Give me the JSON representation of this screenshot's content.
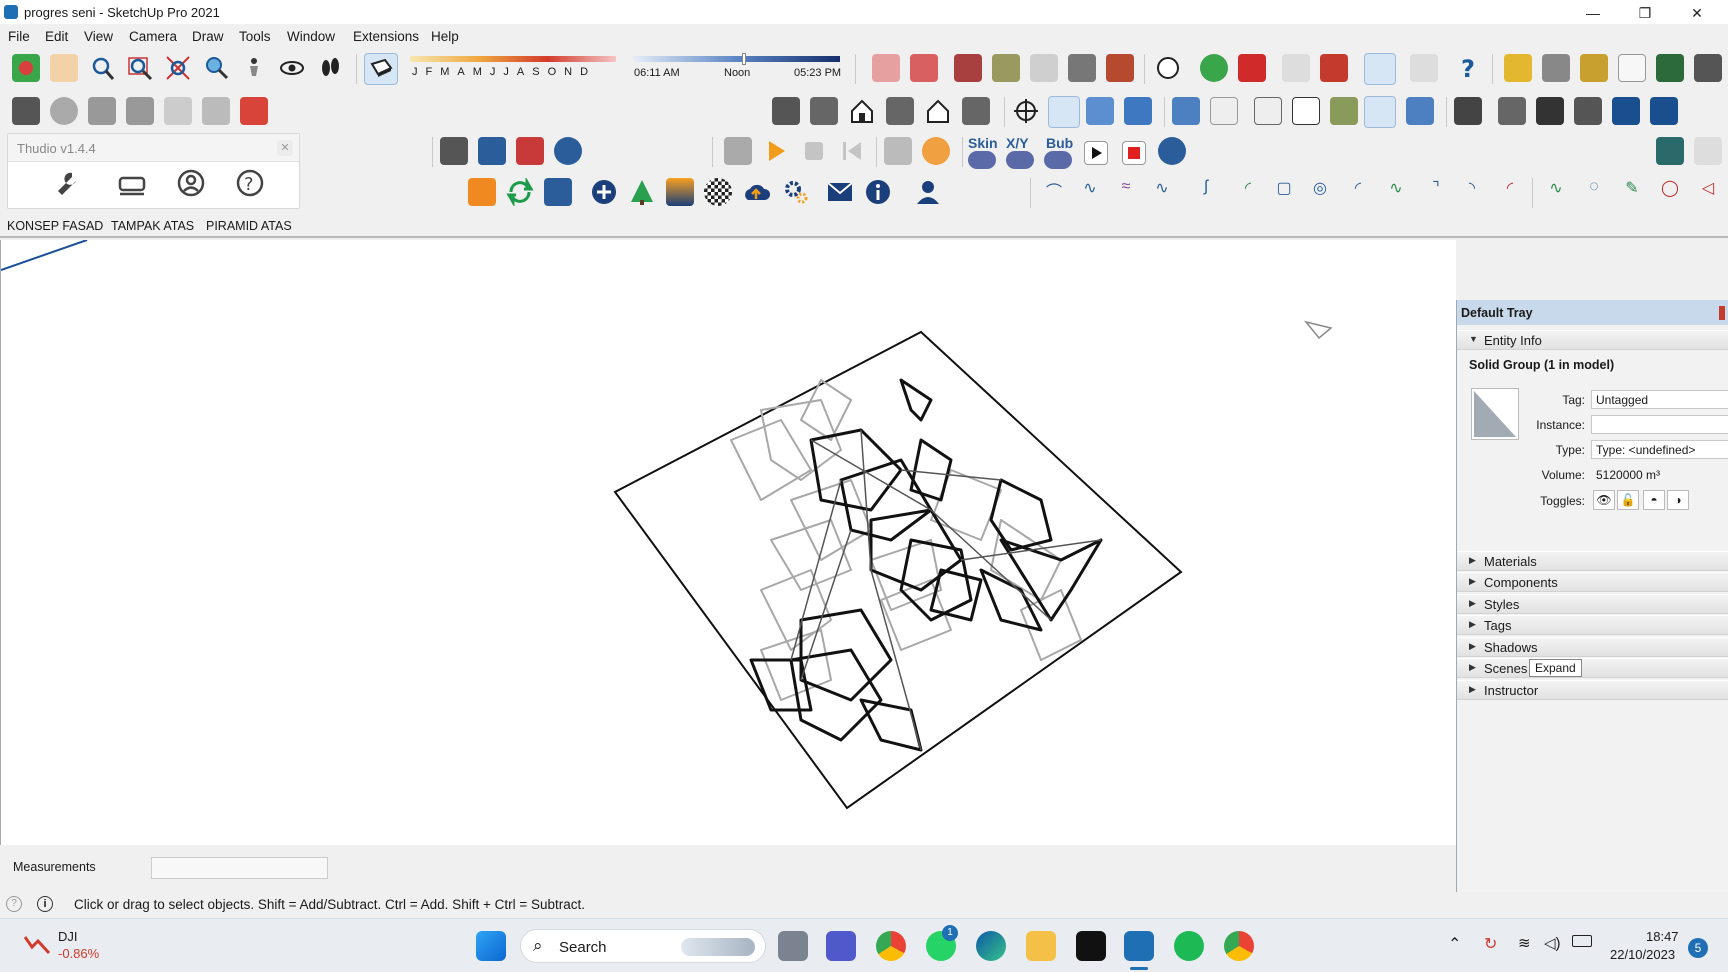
{
  "window": {
    "title": "progres seni - SketchUp Pro 2021",
    "minimize": "—",
    "restore": "❐",
    "close": "✕"
  },
  "menu": [
    "File",
    "Edit",
    "View",
    "Camera",
    "Draw",
    "Tools",
    "Window",
    "Extensions",
    "Help"
  ],
  "shadows": {
    "months": [
      "J",
      "F",
      "M",
      "A",
      "M",
      "J",
      "J",
      "A",
      "S",
      "O",
      "N",
      "D"
    ],
    "time_start": "06:11 AM",
    "time_mid": "Noon",
    "time_end": "05:23 PM"
  },
  "plugins": {
    "skin": "Skin",
    "xy": "X/Y",
    "bub": "Bub"
  },
  "thudio": {
    "title": "Thudio v1.4.4",
    "close": "✕"
  },
  "scenes": [
    "KONSEP FASAD",
    "TAMPAK ATAS",
    "PIRAMID ATAS"
  ],
  "tray": {
    "title": "Default Tray",
    "entity_info_label": "Entity Info",
    "entity_title": "Solid Group (1 in model)",
    "tag_label": "Tag:",
    "tag_value": "Untagged",
    "instance_label": "Instance:",
    "instance_value": "",
    "type_label": "Type:",
    "type_value": "Type: <undefined>",
    "volume_label": "Volume:",
    "volume_value": "5120000 m³",
    "toggles_label": "Toggles:",
    "sections": [
      "Materials",
      "Components",
      "Styles",
      "Tags",
      "Shadows",
      "Scenes",
      "Instructor"
    ],
    "tooltip": "Expand"
  },
  "measurements": {
    "label": "Measurements",
    "value": ""
  },
  "status": {
    "text": "Click or drag to select objects. Shift = Add/Subtract. Ctrl = Add. Shift + Ctrl = Subtract."
  },
  "taskbar": {
    "widget_name": "DJI",
    "widget_value": "-0.86%",
    "search_label": "Search",
    "whatsapp_badge": "1",
    "time": "18:47",
    "date": "22/10/2023",
    "notifications": "5"
  },
  "colors": {
    "accent": "#1f6fb5",
    "tray_header": "#c7d9ea",
    "negative": "#d23b2b",
    "whatsapp": "#25d366",
    "spotify": "#1db954"
  }
}
